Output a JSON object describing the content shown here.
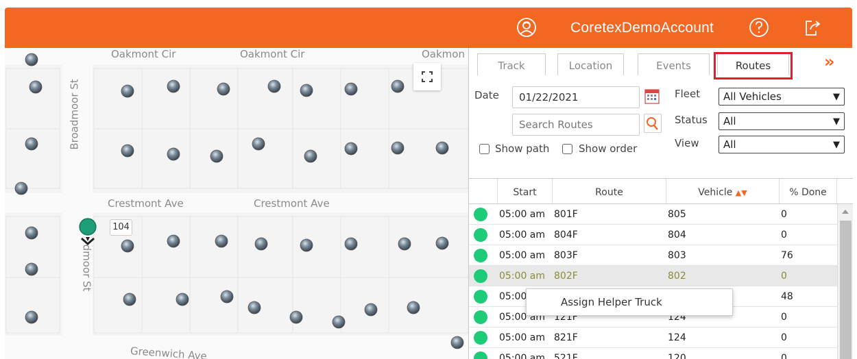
{
  "header": {
    "account_name": "CoretexDemoAccount",
    "brand_color": "#f26722",
    "icons": [
      "user-avatar-icon",
      "help-icon",
      "logout-icon"
    ]
  },
  "map": {
    "streets": [
      "Oakmont Cir",
      "Oakmont Cir",
      "Oakmon",
      "Broadmoor St",
      "Crestmont Ave",
      "Crestmont Ave",
      "dmoor St",
      "Greenwich Ave"
    ],
    "vehicle_label": "104"
  },
  "tabs": [
    {
      "label": "Track"
    },
    {
      "label": "Location"
    },
    {
      "label": "Events"
    },
    {
      "label": "Routes",
      "active": true
    }
  ],
  "filters": {
    "date_label": "Date",
    "date_value": "01/22/2021",
    "search_placeholder": "Search Routes",
    "fleet_label": "Fleet",
    "fleet_value": "All Vehicles",
    "status_label": "Status",
    "status_value": "All",
    "view_label": "View",
    "view_value": "All",
    "show_path_label": "Show path",
    "show_order_label": "Show order"
  },
  "table": {
    "columns": [
      "Start",
      "Route",
      "Vehicle",
      "% Done"
    ],
    "rows": [
      {
        "start": "05:00 am",
        "route": "801F",
        "vehicle": "805",
        "done": "0",
        "status_color": "#1ecb78"
      },
      {
        "start": "05:00 am",
        "route": "804F",
        "vehicle": "804",
        "done": "0",
        "status_color": "#1ecb78"
      },
      {
        "start": "05:00 am",
        "route": "803F",
        "vehicle": "803",
        "done": "76",
        "status_color": "#1ecb78"
      },
      {
        "start": "05:00 am",
        "route": "802F",
        "vehicle": "802",
        "done": "0",
        "status_color": "#1ecb78",
        "selected": true
      },
      {
        "start": "05:00",
        "route": "",
        "vehicle": "",
        "done": "48",
        "status_color": "#1ecb78"
      },
      {
        "start": "05:00 am",
        "route": "121F",
        "vehicle": "124",
        "done": "0",
        "status_color": "#1ecb78"
      },
      {
        "start": "05:00 am",
        "route": "821F",
        "vehicle": "124",
        "done": "0",
        "status_color": "#1ecb78"
      },
      {
        "start": "05:00 am",
        "route": "521F",
        "vehicle": "120",
        "done": "0",
        "status_color": "#1ecb78"
      }
    ]
  },
  "context_menu": {
    "item": "Assign Helper Truck"
  },
  "colors": {
    "accent": "#f26722",
    "highlight": "#e01f2b",
    "status_green": "#1ecb78"
  }
}
